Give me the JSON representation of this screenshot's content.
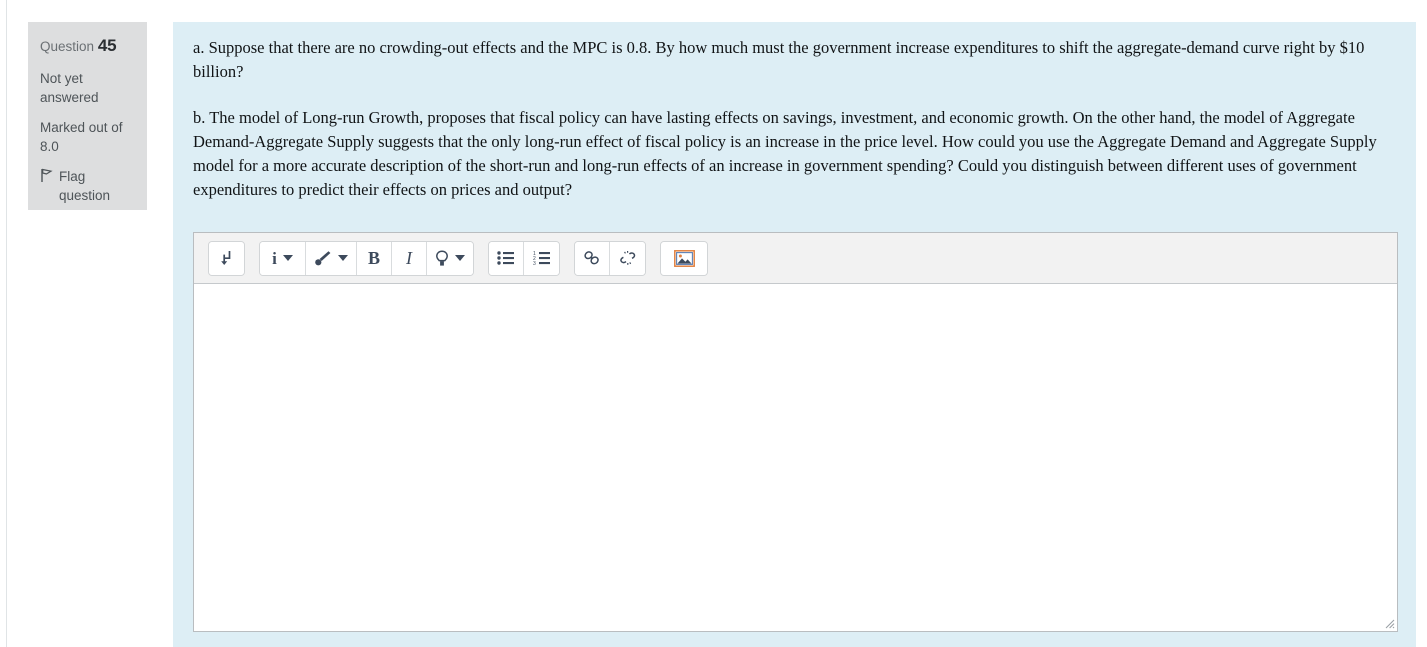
{
  "question_info": {
    "question_label": "Question",
    "question_number": "45",
    "status": "Not yet answered",
    "marks": "Marked out of 8.0",
    "flag_label": "Flag question",
    "flag_icon": "flag-icon"
  },
  "question": {
    "part_a": "a. Suppose that there are no crowding-out effects and the MPC is 0.8. By how much must the government increase expenditures to shift the aggregate-demand curve right by $10 billion?",
    "part_b": "b. The model of Long-run Growth, proposes that fiscal policy can have lasting effects on savings, investment, and economic growth. On the other hand, the model of Aggregate Demand-Aggregate Supply suggests that the only long-run effect of fiscal policy is an increase in the price level. How could you use the Aggregate Demand and Aggregate Supply model for a more accurate description of the short-run and long-run effects of an increase in government spending? Could you distinguish between different uses of government expenditures to predict their effects on prices and output?"
  },
  "editor": {
    "answer_value": "",
    "answer_placeholder": "",
    "toolbar": {
      "groups": [
        {
          "buttons": [
            {
              "name": "expand-toolbar-button",
              "icon": "arrow-down-turn-icon",
              "label": "",
              "has_caret": false
            }
          ]
        },
        {
          "buttons": [
            {
              "name": "paragraph-style-button",
              "icon": "info-icon",
              "label": "i",
              "has_caret": true
            },
            {
              "name": "text-color-button",
              "icon": "paintbrush-icon",
              "label": "",
              "has_caret": true
            },
            {
              "name": "bold-button",
              "icon": "bold-icon",
              "label": "B",
              "has_caret": false
            },
            {
              "name": "italic-button",
              "icon": "italic-icon",
              "label": "I",
              "has_caret": false
            },
            {
              "name": "insert-suggestion-button",
              "icon": "lightbulb-icon",
              "label": "",
              "has_caret": true
            }
          ]
        },
        {
          "buttons": [
            {
              "name": "bulleted-list-button",
              "icon": "bulleted-list-icon",
              "label": "",
              "has_caret": false
            },
            {
              "name": "numbered-list-button",
              "icon": "numbered-list-icon",
              "label": "",
              "has_caret": false
            }
          ]
        },
        {
          "buttons": [
            {
              "name": "insert-link-button",
              "icon": "link-icon",
              "label": "",
              "has_caret": false
            },
            {
              "name": "remove-link-button",
              "icon": "unlink-icon",
              "label": "",
              "has_caret": false
            }
          ]
        },
        {
          "buttons": [
            {
              "name": "insert-image-button",
              "icon": "image-icon",
              "label": "",
              "has_caret": false
            }
          ]
        }
      ]
    },
    "resize_handle_icon": "resize-grip-icon"
  },
  "colors": {
    "content_background": "#ddeef5",
    "sidebar_background": "#dddedf",
    "toolbar_background": "#f2f2f2",
    "icon_color": "#3d4a5c",
    "image_icon_accent": "#e08040"
  }
}
